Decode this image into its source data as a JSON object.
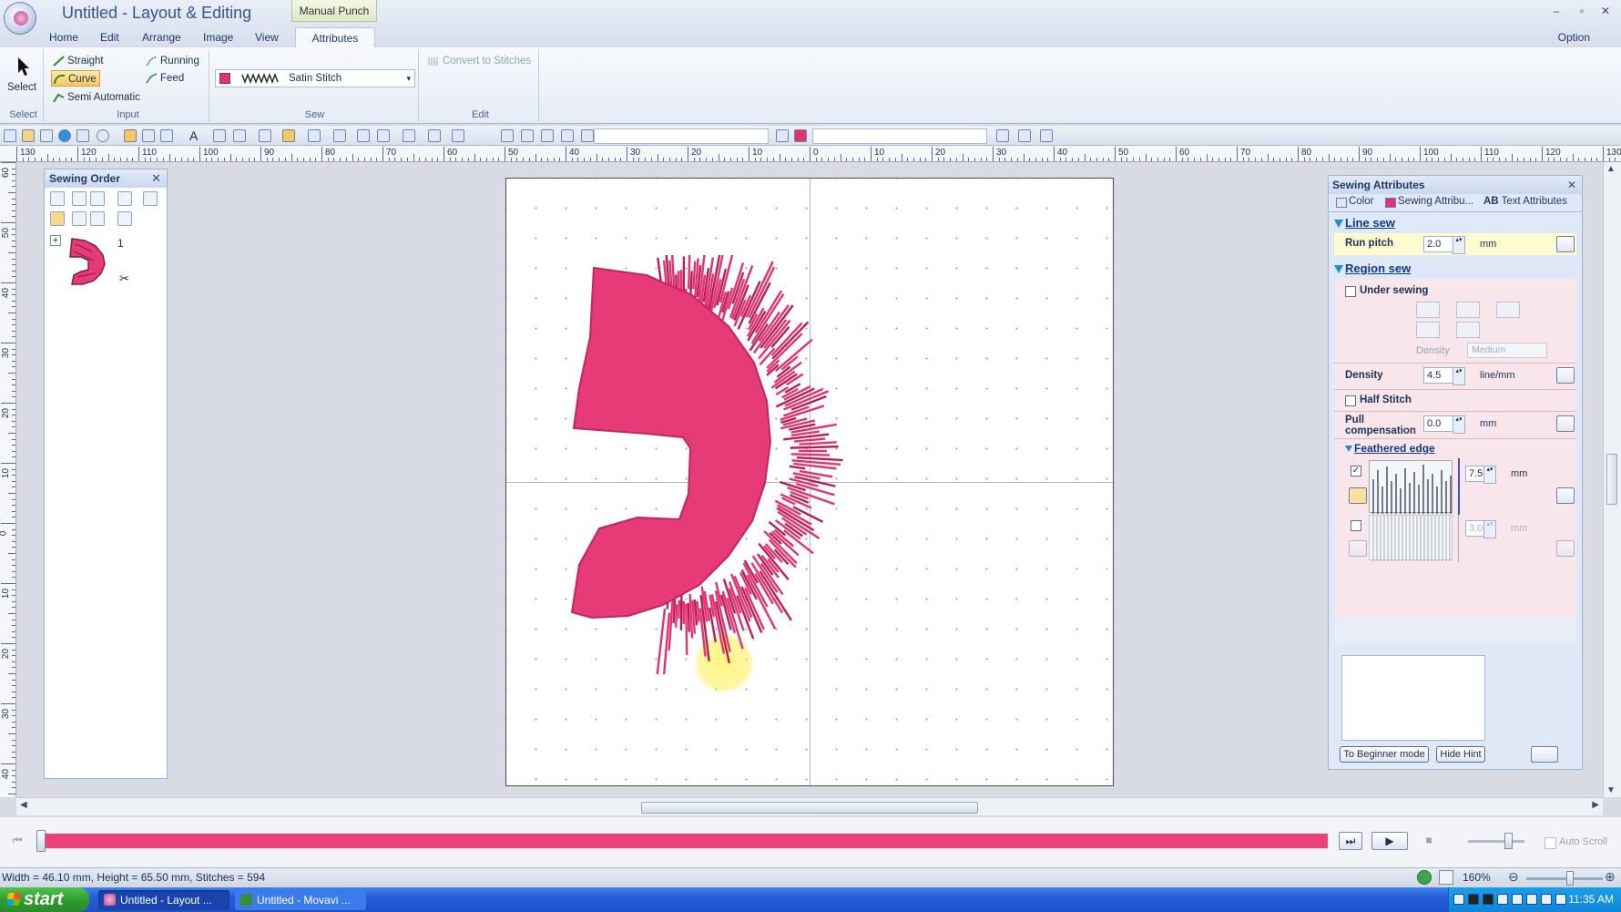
{
  "window": {
    "title": "Untitled - Layout & Editing",
    "context_tab": "Manual Punch",
    "controls": [
      "–",
      "▫",
      "✕"
    ]
  },
  "menu": {
    "tabs": [
      "Home",
      "Edit",
      "Arrange",
      "Image",
      "View",
      "Attributes"
    ],
    "active_tab": "Attributes",
    "option": "Option"
  },
  "ribbon": {
    "select_label": "Select",
    "select_group": "Select",
    "input": {
      "straight": "Straight",
      "curve": "Curve",
      "semi_automatic": "Semi Automatic",
      "running": "Running",
      "feed": "Feed",
      "group_label": "Input"
    },
    "sew": {
      "stitch_type": "Satin Stitch",
      "color": "#e3336f",
      "group_label": "Sew"
    },
    "edit": {
      "convert_label": "Convert to Stitches",
      "group_label": "Edit"
    }
  },
  "ruler": {
    "top_labels": [
      "130",
      "120",
      "110",
      "100",
      "90",
      "80",
      "70",
      "60",
      "50",
      "40",
      "30",
      "20",
      "10",
      "0",
      "10",
      "20",
      "30",
      "40",
      "50",
      "60",
      "70",
      "80",
      "90",
      "100",
      "110",
      "120",
      "130"
    ],
    "left_labels": [
      "60",
      "50",
      "40",
      "30",
      "20",
      "10",
      "0",
      "10",
      "20",
      "30",
      "40",
      "50",
      "60"
    ]
  },
  "sewing_order": {
    "title": "Sewing Order",
    "items": [
      {
        "index": "1",
        "color": "#e3336f"
      }
    ]
  },
  "attributes": {
    "title": "Sewing Attributes",
    "tabs": [
      "Color",
      "Sewing Attribu...",
      "Text Attributes"
    ],
    "tab_prefix": "AB",
    "line_sew": {
      "title": "Line sew",
      "run_pitch_label": "Run pitch",
      "run_pitch": "2.0",
      "unit": "mm"
    },
    "region_sew": {
      "title": "Region sew",
      "under_sewing": "Under sewing",
      "under_density_label": "Density",
      "under_density_value": "Medium",
      "density_label": "Density",
      "density": "4.5",
      "density_unit": "line/mm",
      "half_stitch": "Half Stitch",
      "pull_comp_label": "Pull compensation",
      "pull_comp": "0.0",
      "pull_unit": "mm"
    },
    "feathered_edge": {
      "title": "Feathered edge",
      "value_1": "7.5",
      "value_2": "3.0",
      "unit": "mm",
      "enabled_1": true,
      "enabled_2": false
    },
    "buttons": {
      "beginner": "To Beginner mode",
      "hide_hint": "Hide Hint"
    }
  },
  "playback": {
    "progress": 1.0,
    "auto_scroll": "Auto Scroll"
  },
  "status": {
    "text": "Width = 46.10 mm, Height = 65.50 mm, Stitches = 594",
    "zoom": "160%"
  },
  "taskbar": {
    "start": "start",
    "tasks": [
      "Untitled - Layout ...",
      "Untitled - Movavi ..."
    ],
    "clock": "11:35 AM"
  }
}
